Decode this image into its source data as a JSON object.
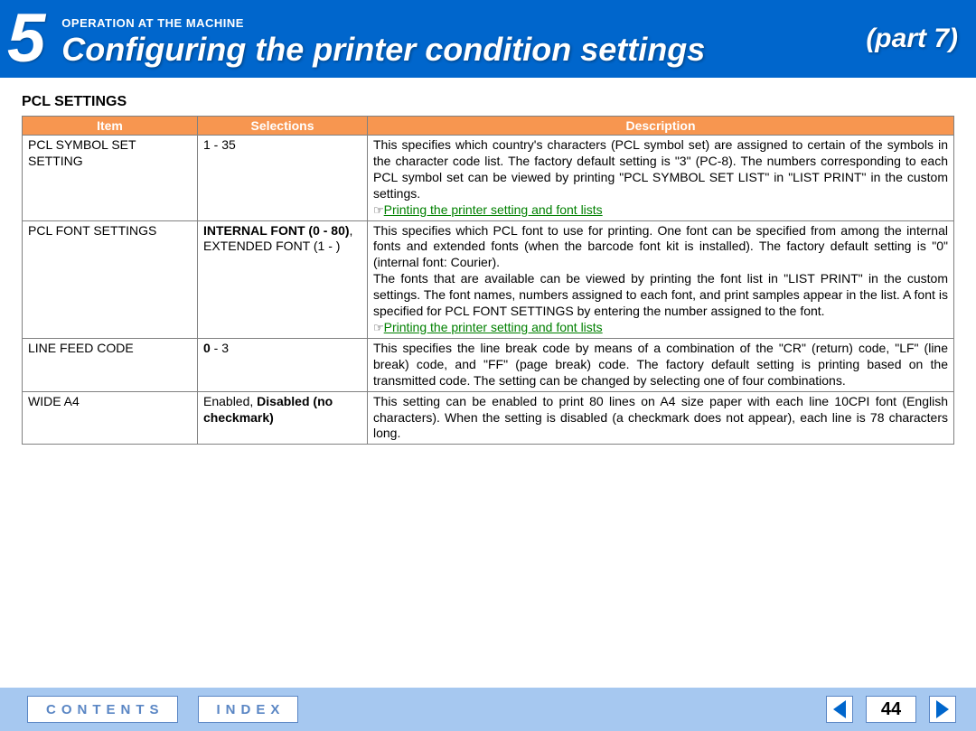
{
  "header": {
    "chapter_num": "5",
    "super_title": "OPERATION AT THE MACHINE",
    "title": "Configuring the printer condition settings",
    "part": "(part 7)"
  },
  "section_heading": "PCL SETTINGS",
  "table": {
    "head": {
      "item": "Item",
      "selections": "Selections",
      "description": "Description"
    },
    "rows": [
      {
        "item": "PCL SYMBOL SET SETTING",
        "sel_plain": "1 - 35",
        "desc_plain": "This specifies which country's characters (PCL symbol set) are assigned to certain of the symbols in the character code list. The factory default setting is \"3\" (PC-8). The numbers corresponding to each PCL symbol set can be viewed by printing \"PCL SYMBOL SET LIST\" in \"LIST PRINT\" in the custom settings.",
        "link_text": "Printing the printer setting and font lists"
      },
      {
        "item": "PCL FONT SETTINGS",
        "sel_bold": "INTERNAL FONT (0 - 80)",
        "sel_rest": ", EXTENDED FONT (1 - )",
        "desc_p1": "This specifies which PCL font to use for printing. One font can be specified from among the internal fonts and extended fonts (when the barcode font kit is installed). The factory default setting is \"0\" (internal font: Courier).",
        "desc_p2": "The fonts that are available can be viewed by printing the font list in \"LIST PRINT\" in the custom settings. The font names, numbers assigned to each font, and print samples appear in the list. A font is specified for PCL FONT SETTINGS by entering the number assigned to the font.",
        "link_text": "Printing the printer setting and font lists"
      },
      {
        "item": "LINE FEED CODE",
        "sel_bold": "0",
        "sel_rest": " - 3",
        "desc_plain": "This specifies the line break code by means of a combination of the \"CR\" (return) code, \"LF\" (line break) code, and \"FF\" (page break) code. The factory default setting is printing based on the transmitted code. The setting can be changed by selecting one of four combinations."
      },
      {
        "item": "WIDE A4",
        "sel_plain": "Enabled, ",
        "sel_bold_after": "Disabled (no checkmark)",
        "desc_plain": "This setting can be enabled to print 80 lines on A4 size paper with each line 10CPI font (English characters). When the setting is disabled (a checkmark does not appear), each line is 78 characters long."
      }
    ]
  },
  "footer": {
    "contents": "CONTENTS",
    "index": "INDEX",
    "page": "44"
  },
  "icons": {
    "pointer": "☞"
  }
}
